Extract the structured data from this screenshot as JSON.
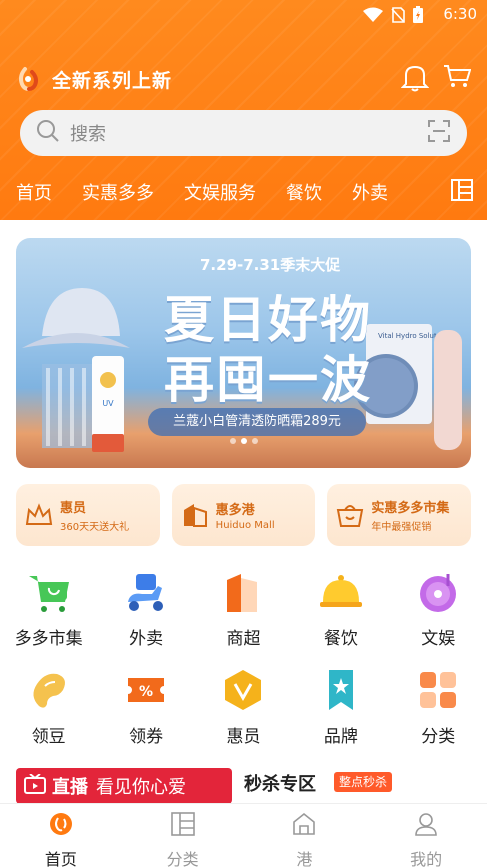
{
  "status": {
    "time": "6:30"
  },
  "header": {
    "brand_title": "全新系列上新",
    "search_placeholder": "搜索",
    "nav": [
      "首页",
      "实惠多多",
      "文娱服务",
      "餐饮",
      "外卖"
    ]
  },
  "banner": {
    "subtitle": "7.29-7.31季末大促",
    "title_line1": "夏日好物",
    "title_line2": "再囤一波",
    "promo": "兰蔻小白管清透防晒霜289元",
    "bottle_label": "UV",
    "mask_label": "Vital Hydro Solution",
    "pages": 3,
    "active_page": 2
  },
  "cards": [
    {
      "title": "惠员",
      "sub": "360天天送大礼"
    },
    {
      "title": "惠多港",
      "sub": "Huiduo Mall"
    },
    {
      "title": "实惠多多市集",
      "sub": "年中最强促销"
    }
  ],
  "grid": [
    [
      "多多市集",
      "外卖",
      "商超",
      "餐饮",
      "文娱"
    ],
    [
      "领豆",
      "领券",
      "惠员",
      "品牌",
      "分类"
    ]
  ],
  "live": {
    "title": "直播",
    "subtitle": "看见你心爱"
  },
  "flash": {
    "title": "秒杀专区",
    "badge": "整点秒杀"
  },
  "tabbar": [
    "首页",
    "分类",
    "港",
    "我的"
  ],
  "colors": {
    "accent": "#ff7a10",
    "live_red": "#e3253a",
    "card_text": "#d46a16"
  }
}
